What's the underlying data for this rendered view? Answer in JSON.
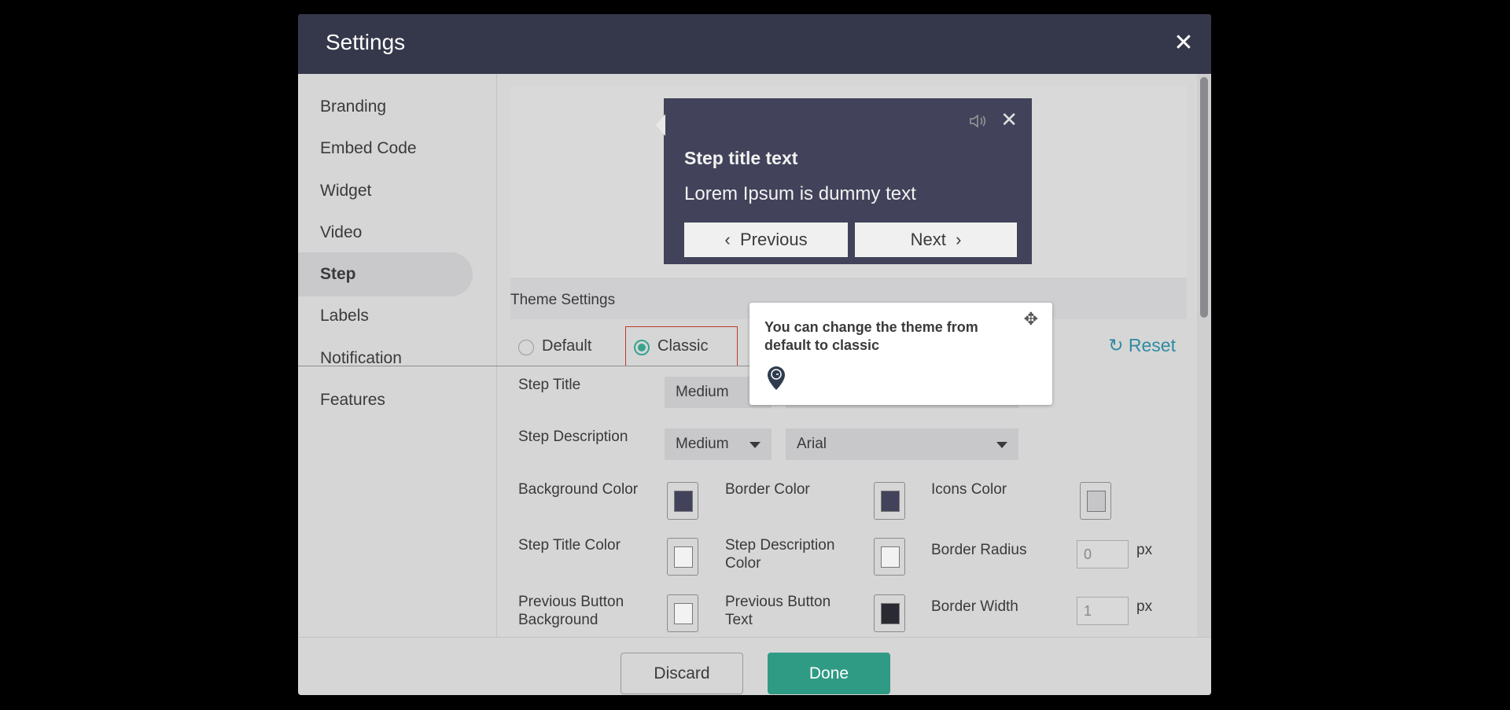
{
  "modal": {
    "title": "Settings"
  },
  "sidebar": {
    "items": [
      {
        "label": "Branding"
      },
      {
        "label": "Embed Code"
      },
      {
        "label": "Widget"
      },
      {
        "label": "Video"
      },
      {
        "label": "Step"
      },
      {
        "label": "Labels"
      },
      {
        "label": "Notification"
      },
      {
        "label": "Features"
      }
    ],
    "active": "Step"
  },
  "preview": {
    "step_title": "Step title text",
    "step_description": "Lorem Ipsum is dummy text",
    "previous_label": "Previous",
    "next_label": "Next"
  },
  "theme": {
    "section_label": "Theme Settings",
    "options": [
      {
        "label": "Default",
        "checked": false
      },
      {
        "label": "Classic",
        "checked": true
      }
    ],
    "reset_label": "Reset"
  },
  "fields": {
    "step_title": {
      "label": "Step Title",
      "size": "Medium"
    },
    "step_description": {
      "label": "Step Description",
      "size": "Medium",
      "font": "Arial"
    },
    "background_color": {
      "label": "Background Color",
      "color": "#42435a"
    },
    "border_color": {
      "label": "Border Color",
      "color": "#42435a"
    },
    "icons_color": {
      "label": "Icons Color",
      "color": "#c6c6c9"
    },
    "step_title_color": {
      "label": "Step Title Color",
      "color": "#ffffff"
    },
    "step_description_color": {
      "label_line1": "Step Description",
      "label_line2": "Color",
      "color": "#ffffff"
    },
    "border_radius": {
      "label": "Border Radius",
      "value": "0",
      "unit": "px"
    },
    "previous_button_background": {
      "label_line1": "Previous Button",
      "label_line2": "Background",
      "color": "#ffffff"
    },
    "previous_button_text": {
      "label_line1": "Previous Button",
      "label_line2": "Text",
      "color": "#2a2a33"
    },
    "border_width": {
      "label": "Border Width",
      "value": "1",
      "unit": "px"
    }
  },
  "tooltip": {
    "text": "You can change the theme from default to classic"
  },
  "footer": {
    "discard_label": "Discard",
    "done_label": "Done"
  },
  "colors": {
    "header_bg": "#35374a",
    "accent": "#2f9b84",
    "reset_link": "#2f8ba3",
    "highlight_border": "#c0392b"
  },
  "icons": {
    "close": "close-icon",
    "sound": "sound-icon",
    "reset": "refresh-icon",
    "move": "move-icon",
    "pin": "location-pin-icon"
  }
}
